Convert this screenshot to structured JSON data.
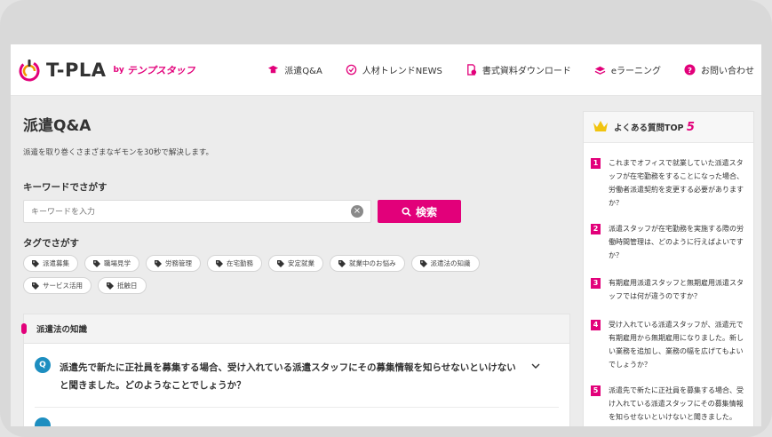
{
  "header": {
    "logo_text": "T-PLA",
    "logo_by": "by",
    "logo_sub": "テンプスタッフ",
    "nav": [
      {
        "label": "派遣Q&A",
        "icon": "graduation-cap-icon"
      },
      {
        "label": "人材トレンドNEWS",
        "icon": "check-circle-icon"
      },
      {
        "label": "書式資料ダウンロード",
        "icon": "document-download-icon"
      },
      {
        "label": "eラーニング",
        "icon": "books-icon"
      },
      {
        "label": "お問い合わせ",
        "icon": "question-icon"
      }
    ]
  },
  "main": {
    "title": "派遣Q&A",
    "description": "派遣を取り巻くさまざまなギモンを30秒で解決します。",
    "keyword_label": "キーワードでさがす",
    "search_placeholder": "キーワードを入力",
    "search_button": "検索",
    "tag_label": "タグでさがす",
    "tags": [
      "派遣募集",
      "職場見学",
      "労務管理",
      "在宅勤務",
      "安定就業",
      "就業中のお悩み",
      "派遣法の知識",
      "サービス活用",
      "抵触日"
    ],
    "section_title": "派遣法の知識",
    "question_badge": "Q",
    "question_line1": "派遣先で新たに正社員を募集する場合、受け入れている派遣スタッフにその募集情報を知らせないといけない",
    "question_line2": "と聞きました。どのようなことでしょうか？"
  },
  "sidebar": {
    "title_prefix": "よくある質問TOP",
    "title_num": "5",
    "items": [
      {
        "rank": "1",
        "text": "これまでオフィスで就業していた派遣スタッフが在宅勤務をすることになった場合、労働者派遣契約を変更する必要がありますか？"
      },
      {
        "rank": "2",
        "text": "派遣スタッフが在宅勤務を実施する際の労働時間管理は、どのように行えばよいですか？"
      },
      {
        "rank": "3",
        "text": "有期雇用派遣スタッフと無期雇用派遣スタッフでは何が違うのですか？"
      },
      {
        "rank": "4",
        "text": "受け入れている派遣スタッフが、派遣元で有期雇用から無期雇用になりました。新しい業務を追加し、業務の幅を広げてもよいでしょうか？"
      },
      {
        "rank": "5",
        "text": "派遣先で新たに正社員を募集する場合、受け入れている派遣スタッフにその募集情報を知らせないといけないと聞きました。"
      }
    ]
  },
  "colors": {
    "accent": "#e2007a",
    "q_badge": "#1d8ec0"
  }
}
